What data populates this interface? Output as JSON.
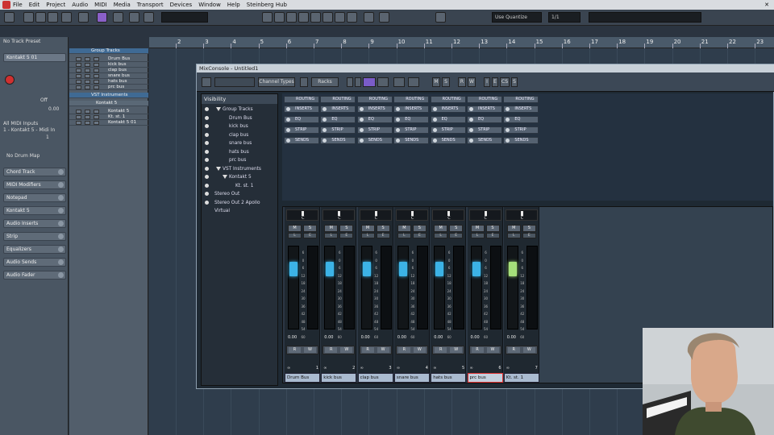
{
  "menubar": {
    "items": [
      "File",
      "Edit",
      "Project",
      "Audio",
      "MIDI",
      "Media",
      "Transport",
      "Devices",
      "Window",
      "Help",
      "Steinberg Hub"
    ]
  },
  "toolbar": {
    "quantize_label": "Use Quantize",
    "grid_value": "1/1"
  },
  "ruler": {
    "bars": [
      "2",
      "3",
      "4",
      "5",
      "6",
      "7",
      "8",
      "9",
      "10",
      "11",
      "12",
      "13",
      "14",
      "15",
      "16",
      "17",
      "18",
      "19",
      "20",
      "21",
      "22",
      "23"
    ]
  },
  "inspector": {
    "track_preset": "No Track Preset",
    "track_name": "Kontakt 5 01",
    "volume_label": "Off",
    "pan_value": "0.00",
    "midi_input": "All MIDI Inputs",
    "midi_output": "1 - Kontakt 5 - Midi In",
    "channel": "1",
    "drum_map": "No Drum Map",
    "sections": [
      "Chord Track",
      "MIDI Modifiers",
      "Notepad",
      "Kontakt 5",
      "Audio Inserts",
      "Strip",
      "Equalizers",
      "Audio Sends",
      "Audio Fader"
    ]
  },
  "tracklist": {
    "rows": [
      {
        "label": "Group Tracks",
        "kind": "folder"
      },
      {
        "label": "Drum Bus",
        "kind": "track"
      },
      {
        "label": "kick bus",
        "kind": "track"
      },
      {
        "label": "clap bus",
        "kind": "track"
      },
      {
        "label": "snare bus",
        "kind": "track"
      },
      {
        "label": "hats bus",
        "kind": "track"
      },
      {
        "label": "prc bus",
        "kind": "track"
      },
      {
        "label": "VST Instruments",
        "kind": "folder"
      },
      {
        "label": "Kontakt 5",
        "kind": "sub"
      },
      {
        "label": "Kontakt 5",
        "kind": "track"
      },
      {
        "label": "Kt. st. 1",
        "kind": "track"
      },
      {
        "label": "Kontakt 5 01",
        "kind": "track"
      }
    ]
  },
  "mixconsole": {
    "title": "MixConsole - Untitled1",
    "toolbar": {
      "channel_types": "Channel Types",
      "racks": "Racks",
      "m": "M",
      "s": "S",
      "r": "R",
      "w": "W",
      "i": "I",
      "e": "E",
      "cs": "CS",
      "s2": "S"
    },
    "visibility": {
      "header": "Visibility",
      "items": [
        "Group Tracks",
        "Drum Bus",
        "kick bus",
        "clap bus",
        "snare bus",
        "hats bus",
        "prc bus",
        "VST Instruments",
        "Kontakt 5",
        "Kt. st. 1",
        "Stereo Out",
        "Stereo Out 2 Apollo Virtual"
      ]
    },
    "racks": [
      "ROUTING",
      "INSERTS",
      "EQ",
      "STRIP",
      "SENDS"
    ],
    "channels": [
      {
        "name": "Drum Bus",
        "number": "1",
        "volume": "0.00",
        "color": "#3cb3e6",
        "fader_level": 0.78
      },
      {
        "name": "kick bus",
        "number": "2",
        "volume": "0.00",
        "color": "#3cb3e6",
        "fader_level": 0.78
      },
      {
        "name": "clap bus",
        "number": "3",
        "volume": "0.00",
        "color": "#3cb3e6",
        "fader_level": 0.78
      },
      {
        "name": "snare bus",
        "number": "4",
        "volume": "0.00",
        "color": "#3cb3e6",
        "fader_level": 0.78
      },
      {
        "name": "hats bus",
        "number": "5",
        "volume": "0.00",
        "color": "#3cb3e6",
        "fader_level": 0.78
      },
      {
        "name": "prc bus",
        "number": "6",
        "volume": "0.00",
        "color": "#3cb3e6",
        "fader_level": 0.78
      },
      {
        "name": "Kt. st. 1",
        "number": "7",
        "volume": "0.00",
        "color": "#a6e07a",
        "fader_level": 0.78
      }
    ],
    "buttons": {
      "m": "M",
      "s": "S",
      "l": "L",
      "e": "E",
      "r": "R",
      "w": "W"
    },
    "fader_scale": [
      "6",
      "0",
      "6",
      "12",
      "18",
      "24",
      "30",
      "36",
      "42",
      "48",
      "54",
      "60"
    ]
  },
  "colors": {
    "accent": "#8a60c8",
    "project_bg": "#2f3d4c",
    "selected_channel_border": "#e03030"
  }
}
